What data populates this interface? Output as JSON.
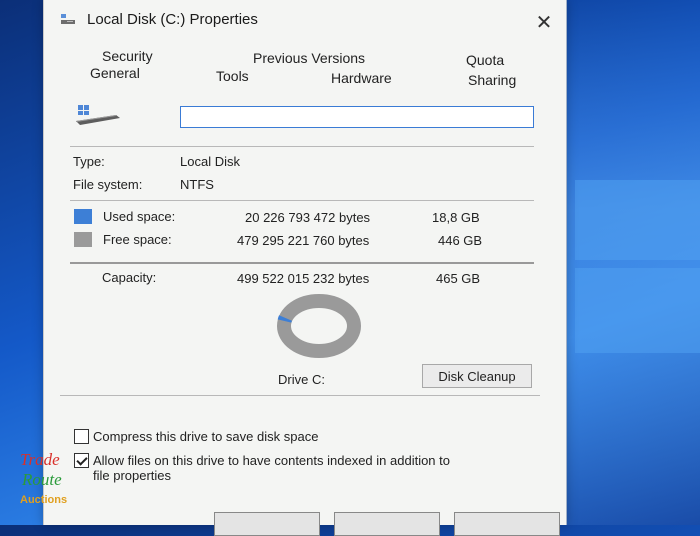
{
  "window": {
    "title": "Local Disk (C:) Properties",
    "close_glyph": "✕"
  },
  "tabs": [
    {
      "label": "Security"
    },
    {
      "label": "Previous Versions"
    },
    {
      "label": "Quota"
    },
    {
      "label": "General"
    },
    {
      "label": "Tools"
    },
    {
      "label": "Hardware"
    },
    {
      "label": "Sharing"
    }
  ],
  "general": {
    "name_value": "",
    "type_label": "Type:",
    "type_value": "Local Disk",
    "fs_label": "File system:",
    "fs_value": "NTFS",
    "used": {
      "label": "Used space:",
      "bytes": "20 226 793 472 bytes",
      "size": "18,8 GB",
      "color": "#3d7fd6"
    },
    "free": {
      "label": "Free space:",
      "bytes": "479 295 221 760 bytes",
      "size": "446 GB",
      "color": "#9a9a9a"
    },
    "capacity": {
      "label": "Capacity:",
      "bytes": "499 522 015 232 bytes",
      "size": "465 GB"
    },
    "drive_label": "Drive C:",
    "cleanup_label": "Disk Cleanup",
    "compress_label": "Compress this drive to save disk space",
    "compress_checked": false,
    "index_label_line1": "Allow files on this drive to have contents indexed in addition to",
    "index_label_line2": "file properties",
    "index_checked": true
  },
  "watermark": {
    "line1": "Trade",
    "line2": "Route",
    "line3": "Auctions"
  }
}
